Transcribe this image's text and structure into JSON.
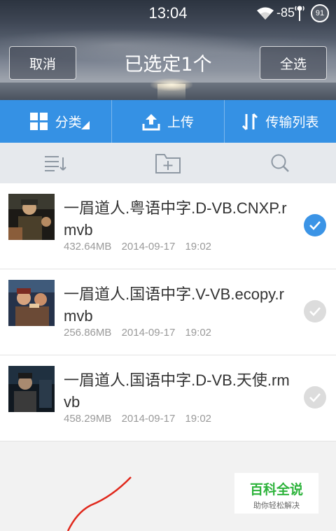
{
  "status_bar": {
    "time": "13:04",
    "signal": "-85",
    "battery": "91"
  },
  "header": {
    "cancel_label": "取消",
    "title": "已选定1个",
    "select_all_label": "全选"
  },
  "tabs": [
    {
      "label": "分类",
      "icon": "grid-icon"
    },
    {
      "label": "上传",
      "icon": "upload-icon"
    },
    {
      "label": "传输列表",
      "icon": "transfer-icon"
    }
  ],
  "toolbar": {
    "icons": [
      "sort-list-icon",
      "new-folder-icon",
      "search-icon"
    ]
  },
  "files": [
    {
      "name": "一眉道人.粤语中字.D-VB.CNXP.rmvb",
      "size": "432.64MB",
      "date": "2014-09-17",
      "time": "19:02",
      "selected": true
    },
    {
      "name": "一眉道人.国语中字.V-VB.ecopy.rmvb",
      "size": "256.86MB",
      "date": "2014-09-17",
      "time": "19:02",
      "selected": false
    },
    {
      "name": "一眉道人.国语中字.D-VB.天使.rmvb",
      "size": "458.29MB",
      "date": "2014-09-17",
      "time": "19:02",
      "selected": false
    }
  ],
  "watermark": {
    "title": "百科全说",
    "subtitle": "助你轻松解决"
  },
  "colors": {
    "accent": "#3591e4",
    "check_on": "#3b94e6",
    "watermark_green": "#2db33b"
  }
}
